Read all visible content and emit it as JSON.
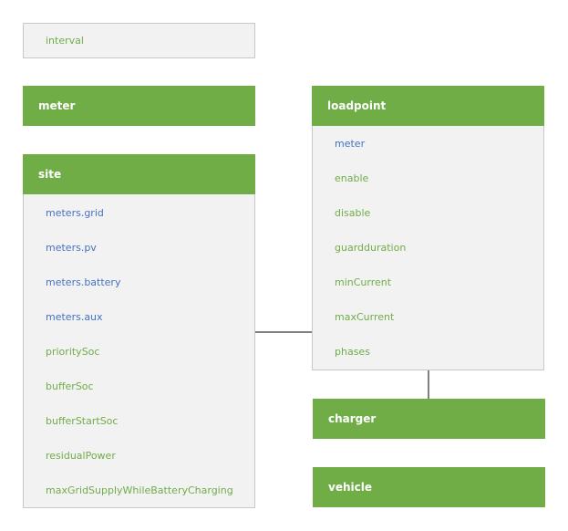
{
  "colors": {
    "header_green": "#70ad47",
    "label_blue": "#4472c4",
    "label_green": "#70ad47",
    "box_gray": "#f2f2f2"
  },
  "interval": {
    "label": "interval"
  },
  "meter": {
    "title": "meter"
  },
  "site": {
    "title": "site",
    "items": [
      {
        "label": "meters.grid",
        "color": "blue"
      },
      {
        "label": "meters.pv",
        "color": "blue"
      },
      {
        "label": "meters.battery",
        "color": "blue"
      },
      {
        "label": "meters.aux",
        "color": "blue"
      },
      {
        "label": "prioritySoc",
        "color": "green"
      },
      {
        "label": "bufferSoc",
        "color": "green"
      },
      {
        "label": "bufferStartSoc",
        "color": "green"
      },
      {
        "label": "residualPower",
        "color": "green"
      },
      {
        "label": "maxGridSupplyWhileBatteryCharging",
        "color": "green"
      }
    ]
  },
  "loadpoint": {
    "title": "loadpoint",
    "items": [
      {
        "label": "meter",
        "color": "blue"
      },
      {
        "label": "enable",
        "color": "green"
      },
      {
        "label": "disable",
        "color": "green"
      },
      {
        "label": "guardduration",
        "color": "green"
      },
      {
        "label": "minCurrent",
        "color": "green"
      },
      {
        "label": "maxCurrent",
        "color": "green"
      },
      {
        "label": "phases",
        "color": "green"
      }
    ]
  },
  "charger": {
    "title": "charger"
  },
  "vehicle": {
    "title": "vehicle"
  }
}
